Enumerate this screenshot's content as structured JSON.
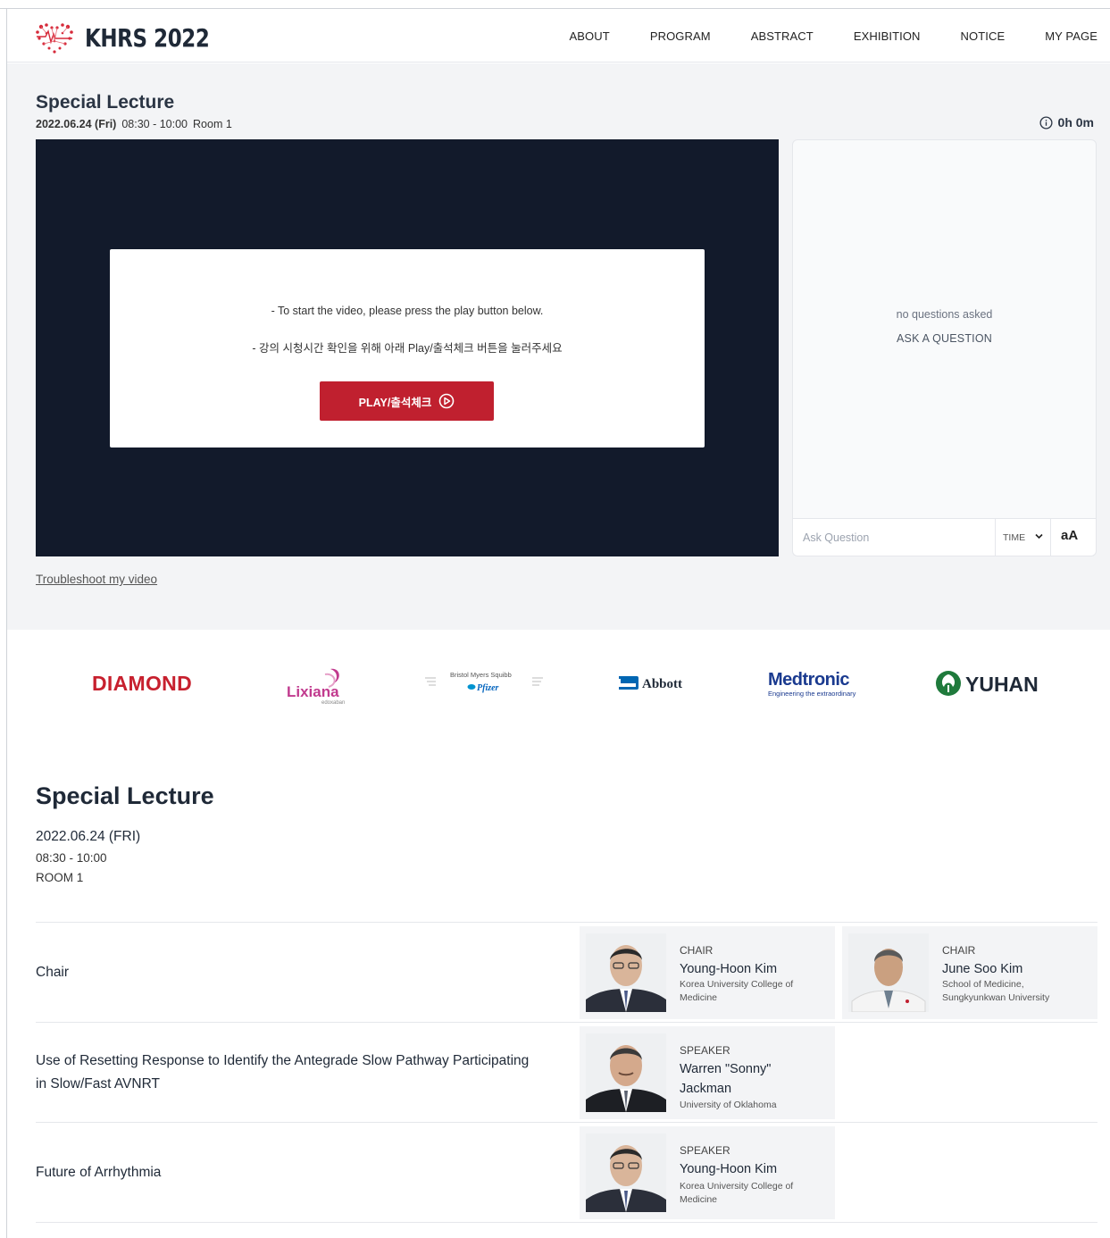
{
  "header": {
    "brand": "KHRS 2022",
    "nav": [
      "ABOUT",
      "PROGRAM",
      "ABSTRACT",
      "EXHIBITION",
      "NOTICE",
      "MY PAGE"
    ]
  },
  "live": {
    "title": "Special Lecture",
    "date": "2022.06.24 (Fri)",
    "time": "08:30 - 10:00",
    "room": "Room 1",
    "timer": "0h 0m",
    "notice_en": "- To start the video, please press the play button below.",
    "notice_ko": "- 강의 시청시간 확인을 위해 아래 Play/출석체크 버튼을 눌러주세요",
    "play_label": "PLAY/출석체크",
    "troubleshoot": "Troubleshoot my video"
  },
  "qa": {
    "empty_text": "no questions asked",
    "ask_label": "ASK A QUESTION",
    "input_placeholder": "Ask Question",
    "sort_value": "TIME",
    "font_toggle": "aA"
  },
  "sponsors": {
    "diamond": "DIAMOND",
    "lixiana": "Lixiana",
    "lixiana_sub": "edoxaban",
    "bms": "Bristol Myers Squibb",
    "pfizer": "Pfizer",
    "abbott": "Abbott",
    "medtronic": "Medtronic",
    "medtronic_sub": "Engineering the extraordinary",
    "yuhan": "YUHAN"
  },
  "detail": {
    "title": "Special Lecture",
    "date": "2022.06.24 (FRI)",
    "time": "08:30 - 10:00",
    "room": "ROOM 1",
    "rows": [
      {
        "label": "Chair",
        "people": [
          {
            "role": "CHAIR",
            "name": "Young-Hoon Kim",
            "affiliation": "Korea University College of Medicine"
          },
          {
            "role": "CHAIR",
            "name": "June Soo Kim",
            "affiliation": "School of Medicine, Sungkyunkwan University"
          }
        ]
      },
      {
        "label": "Use of Resetting Response to Identify the Antegrade Slow Pathway Participating in Slow/Fast AVNRT",
        "people": [
          {
            "role": "SPEAKER",
            "name": "Warren \"Sonny\" Jackman",
            "affiliation": "University of Oklahoma"
          }
        ]
      },
      {
        "label": "Future of Arrhythmia",
        "people": [
          {
            "role": "SPEAKER",
            "name": "Young-Hoon Kim",
            "affiliation": "Korea University College of Medicine"
          }
        ]
      }
    ]
  },
  "colors": {
    "accent_red": "#c0202f",
    "video_bg": "#121a2b",
    "page_bg": "#f3f4f6"
  }
}
